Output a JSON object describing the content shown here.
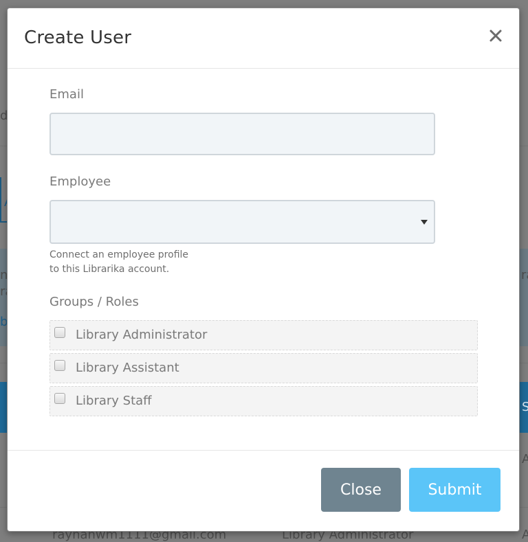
{
  "background": {
    "text_fragments": [
      "d",
      "A",
      "nc",
      "ra",
      "ra",
      "b",
      "S",
      "A",
      "A"
    ],
    "email_row": "rayhanwm1111@gmail.com",
    "role_row": "Library Administrator"
  },
  "modal": {
    "title": "Create User",
    "close_icon": "close-icon",
    "email": {
      "label": "Email",
      "value": "",
      "placeholder": ""
    },
    "employee": {
      "label": "Employee",
      "selected": "",
      "help_line1": "Connect an employee profile",
      "help_line2": "to this Librarika account."
    },
    "groups": {
      "label": "Groups / Roles",
      "options": [
        {
          "label": "Library Administrator",
          "checked": false
        },
        {
          "label": "Library Assistant",
          "checked": false
        },
        {
          "label": "Library Staff",
          "checked": false
        }
      ]
    },
    "footer": {
      "close_label": "Close",
      "submit_label": "Submit"
    }
  },
  "colors": {
    "submit": "#5bc5f8",
    "close": "#6f8490",
    "backdrop": "#7e7e7e"
  }
}
